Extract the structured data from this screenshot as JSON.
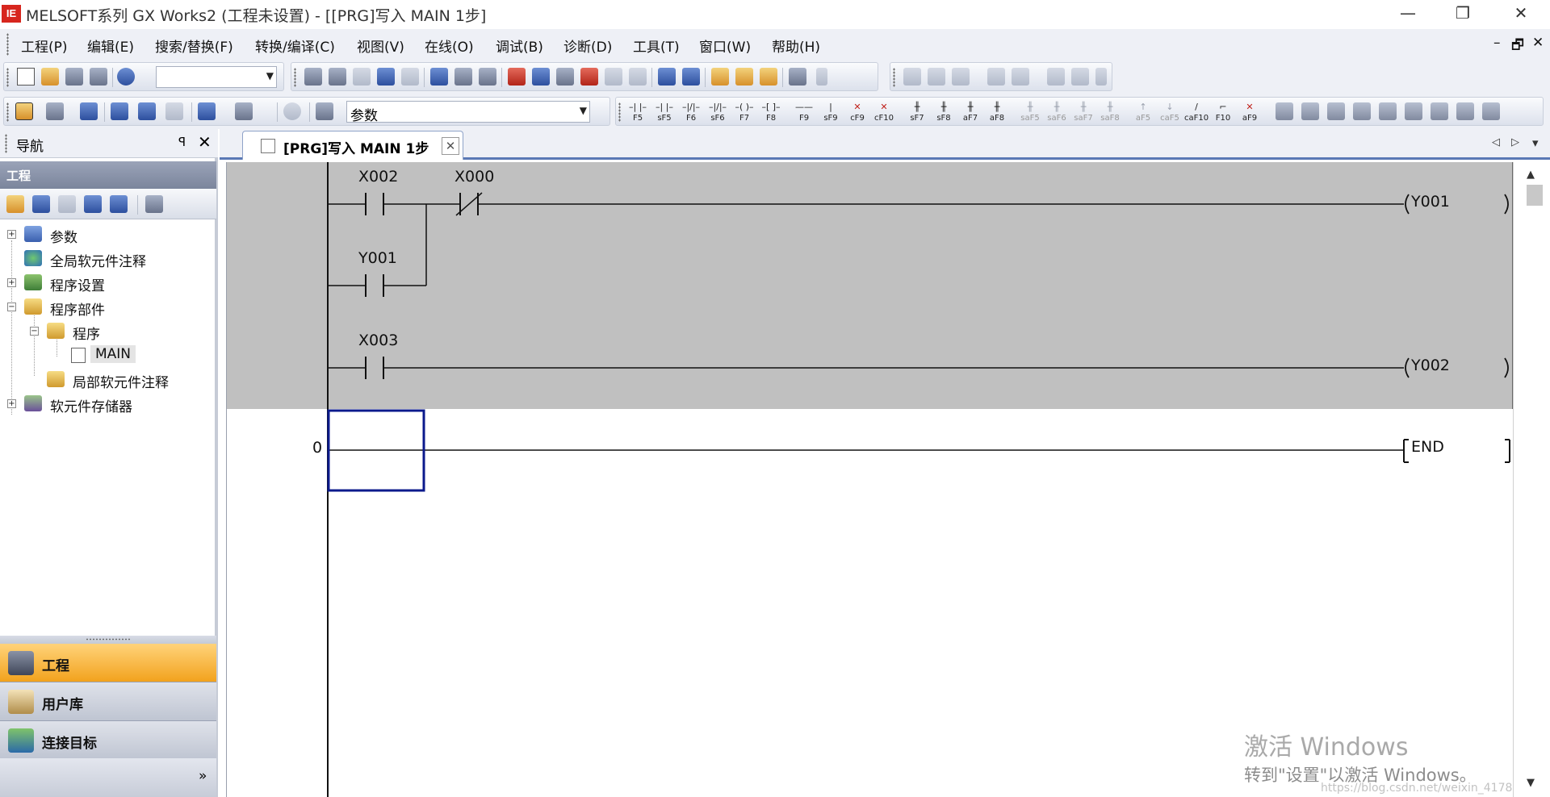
{
  "window": {
    "app_icon_text": "IE",
    "title": "MELSOFT系列 GX Works2 (工程未设置) - [[PRG]写入 MAIN 1步]",
    "minimize_glyph": "—",
    "restore_glyph": "❐",
    "close_glyph": "✕"
  },
  "menu": {
    "items": [
      "工程(P)",
      "编辑(E)",
      "搜索/替换(F)",
      "转换/编译(C)",
      "视图(V)",
      "在线(O)",
      "调试(B)",
      "诊断(D)",
      "工具(T)",
      "窗口(W)",
      "帮助(H)"
    ],
    "mdi_minimize": "–",
    "mdi_restore": "🗗",
    "mdi_close": "✕"
  },
  "toolbar": {
    "combo1_value": "",
    "combo2_value": "参数",
    "ladder_keys": [
      "F5",
      "sF5",
      "F6",
      "sF6",
      "F7",
      "F8",
      "F9",
      "sF9",
      "cF9",
      "cF10",
      "sF7",
      "sF8",
      "aF7",
      "aF8",
      "saF5",
      "saF6",
      "saF7",
      "saF8",
      "aF5",
      "caF5",
      "caF10",
      "F10",
      "aF9"
    ]
  },
  "navigation": {
    "title": "导航",
    "pin_glyph": "ꟼ",
    "close_glyph": "✕",
    "section_label": "工程",
    "tree": [
      {
        "label": "参数",
        "expander": "+"
      },
      {
        "label": "全局软元件注释",
        "expander": ""
      },
      {
        "label": "程序设置",
        "expander": "+"
      },
      {
        "label": "程序部件",
        "expander": "−"
      },
      {
        "label": "程序",
        "expander": "−"
      },
      {
        "label": "MAIN",
        "expander": ""
      },
      {
        "label": "局部软元件注释",
        "expander": ""
      },
      {
        "label": "软元件存储器",
        "expander": "+"
      }
    ],
    "tabs": [
      {
        "label": "工程",
        "active": true
      },
      {
        "label": "用户库",
        "active": false
      },
      {
        "label": "连接目标",
        "active": false
      }
    ],
    "more_glyph": "»"
  },
  "document": {
    "tab_label": "[PRG]写入 MAIN 1步",
    "tab_close_glyph": "✕",
    "scroll_left_glyph": "◁",
    "scroll_right_glyph": "▷",
    "tab_menu_glyph": "▾"
  },
  "ladder": {
    "rung1": {
      "contacts": [
        "X002",
        "X000"
      ],
      "branch_contact": "Y001",
      "coil": "Y001"
    },
    "rung2": {
      "contacts": [
        "X003"
      ],
      "coil": "Y002"
    },
    "end_rung": {
      "step": "0",
      "instruction": "END"
    }
  },
  "scrollbar": {
    "up_glyph": "▲",
    "down_glyph": "▼"
  },
  "watermark": {
    "line1": "激活 Windows",
    "line2": "转到\"设置\"以激活 Windows。",
    "line3": "https://blog.csdn.net/weixin_4178..."
  },
  "colors": {
    "selection_box": "#0b1a8c",
    "gray_block": "#c0c0c0",
    "active_nav_tab": "#f6a829"
  }
}
